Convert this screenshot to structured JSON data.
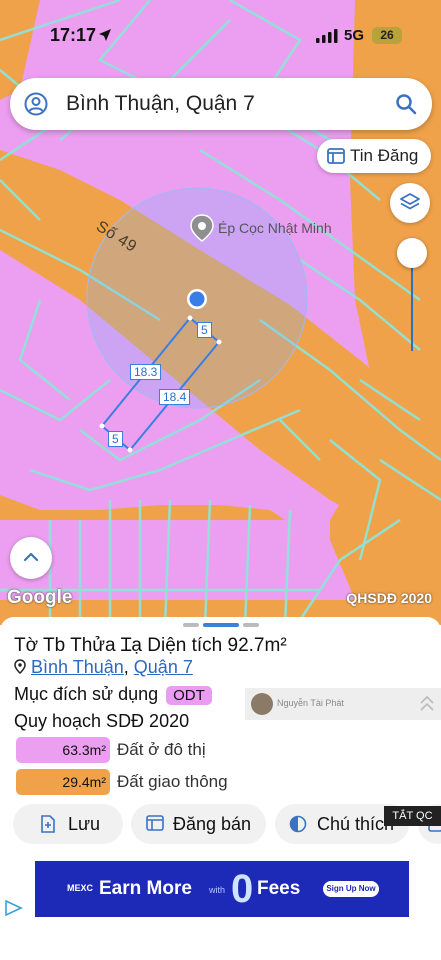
{
  "status": {
    "time": "17:17",
    "network": "5G",
    "battery": "26"
  },
  "search": {
    "query": "Bình Thuận, Quận 7"
  },
  "map": {
    "tin_dang_label": "Tin Đăng",
    "road_label": "Số 49",
    "poi_label": "Ép Cọc Nhật Minh",
    "google_label": "Google",
    "layer_label": "QHSDĐ 2020",
    "dims": [
      "5",
      "18.3",
      "18.4",
      "5"
    ],
    "colors": {
      "residential": "#ec9ff0",
      "transport": "#f0a24a",
      "lines": "#8fe3d8"
    }
  },
  "panel": {
    "title": "Tờ Tb Thửa Ɪạ Diện tích 92.7m²",
    "ward": "Bình Thuận",
    "district": "Quận 7",
    "separator": ",",
    "purpose_label": "Mục đích sử dụng",
    "purpose_code": "ODT",
    "plan_label": "Quy hoạch SDĐ 2020",
    "owner_name": "Nguyễn Tài Phát",
    "legend": [
      {
        "value": "63.3m²",
        "label": "Đất ở đô thị",
        "color": "#ec9ff0"
      },
      {
        "value": "29.4m²",
        "label": "Đất giao thông",
        "color": "#f0a24a"
      }
    ],
    "actions": {
      "save": "Lưu",
      "post": "Đăng bán",
      "legend": "Chú thích"
    },
    "ad_close": "TẮT QC"
  },
  "ad": {
    "brand": "MEXC",
    "text1": "Earn More",
    "with": "with",
    "zero": "0",
    "text2": "Fees",
    "cta": "Sign Up Now"
  }
}
